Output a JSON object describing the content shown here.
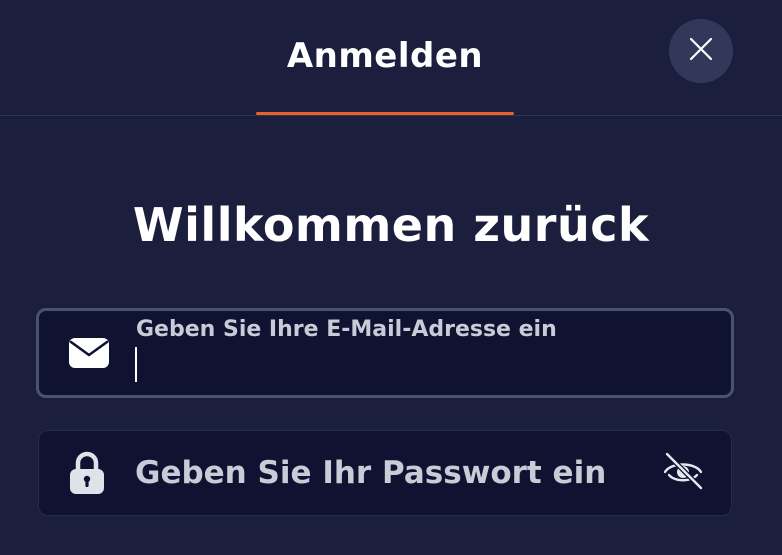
{
  "header": {
    "tab_label": "Anmelden",
    "close_icon": "close-icon",
    "accent_color": "#e8622a"
  },
  "main": {
    "title": "Willkommen zurück",
    "email": {
      "icon": "envelope-icon",
      "label": "Geben Sie Ihre E-Mail-Adresse ein",
      "value": ""
    },
    "password": {
      "icon": "lock-icon",
      "placeholder": "Geben Sie Ihr Passwort ein",
      "value": "",
      "toggle_icon": "eye-slash-icon"
    }
  },
  "colors": {
    "background": "#1b1f3d",
    "field_background": "#0f1331",
    "close_button": "#33385a"
  }
}
